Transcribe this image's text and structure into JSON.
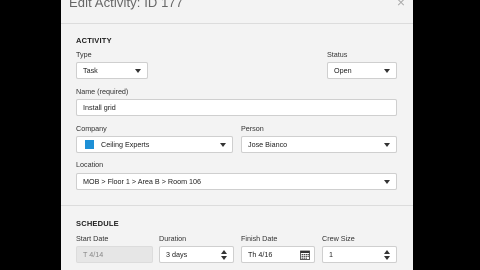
{
  "dialog": {
    "title": "Edit Activity: ID 177",
    "close_label": "×"
  },
  "activity": {
    "section_label": "ACTIVITY",
    "type": {
      "label": "Type",
      "value": "Task"
    },
    "status": {
      "label": "Status",
      "value": "Open"
    },
    "name": {
      "label": "Name (required)",
      "value": "Install grid"
    },
    "company": {
      "label": "Company",
      "value": "Ceiling Experts",
      "swatch_color": "#1e90d6"
    },
    "person": {
      "label": "Person",
      "value": "Jose Bianco"
    },
    "location": {
      "label": "Location",
      "value": "MOB > Floor 1 > Area B > Room 106"
    }
  },
  "schedule": {
    "section_label": "SCHEDULE",
    "start_date": {
      "label": "Start Date",
      "value": "T 4/14"
    },
    "duration": {
      "label": "Duration",
      "value": "3 days"
    },
    "finish_date": {
      "label": "Finish Date",
      "value": "Th 4/16",
      "icon": "calendar-icon"
    },
    "crew_size": {
      "label": "Crew Size",
      "value": "1"
    }
  }
}
